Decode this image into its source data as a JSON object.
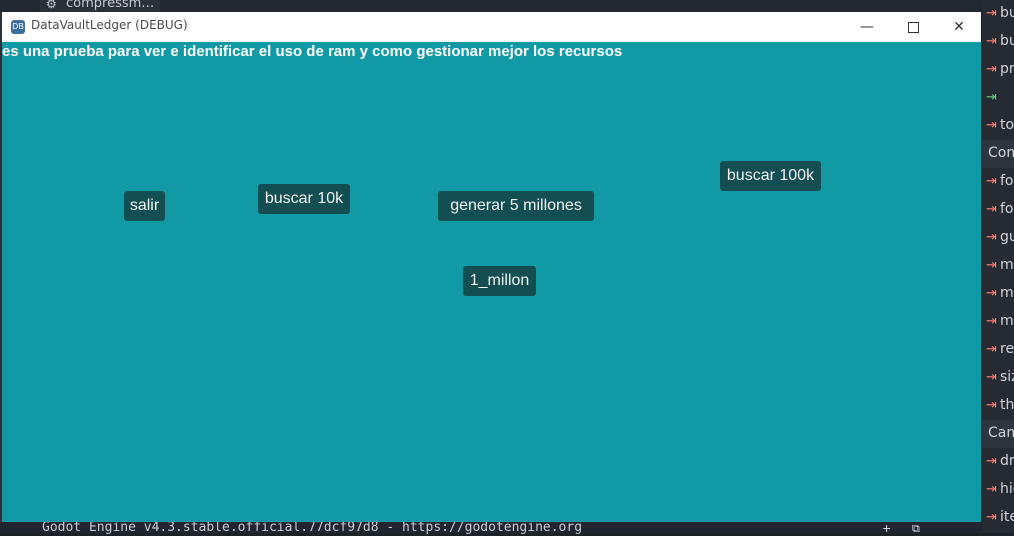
{
  "background_editor": {
    "tab_label": "compressm…",
    "tab_icon": "gear-icon",
    "status_text": "Godot Engine v4.3.stable.official.77dcf97d8 - https://godotengine.org",
    "bottom_buttons": [
      "+",
      "⧉"
    ]
  },
  "inspector": {
    "rows": [
      {
        "icon": "signal-icon",
        "label": "bu"
      },
      {
        "icon": "signal-icon",
        "label": "bu"
      },
      {
        "icon": "signal-icon",
        "label": "pr"
      },
      {
        "icon": "enter-icon",
        "label": ""
      },
      {
        "icon": "signal-icon",
        "label": "to"
      },
      {
        "section": "Con"
      },
      {
        "icon": "signal-icon",
        "label": "fo"
      },
      {
        "icon": "signal-icon",
        "label": "fo"
      },
      {
        "icon": "signal-icon",
        "label": "gu"
      },
      {
        "icon": "signal-icon",
        "label": "m"
      },
      {
        "icon": "signal-icon",
        "label": "m"
      },
      {
        "icon": "signal-icon",
        "label": "m"
      },
      {
        "icon": "signal-icon",
        "label": "re"
      },
      {
        "icon": "signal-icon",
        "label": "siz"
      },
      {
        "icon": "signal-icon",
        "label": "th"
      },
      {
        "section": "Can"
      },
      {
        "icon": "signal-icon",
        "label": "dr"
      },
      {
        "icon": "signal-icon",
        "label": "hic"
      },
      {
        "icon": "signal-icon",
        "label": "ite"
      }
    ]
  },
  "window": {
    "title": "DataVaultLedger (DEBUG)",
    "app_icon_text": "DB",
    "controls": {
      "minimize": "—",
      "close": "✕"
    },
    "info_text": "es una prueba para ver e identificar el uso de ram y como gestionar mejor los recursos",
    "buttons": {
      "salir": "salir",
      "buscar_10k": "buscar 10k",
      "generar_5m": "generar  5 millones",
      "buscar_100k": "buscar 100k",
      "un_millon": "1_millon"
    }
  }
}
